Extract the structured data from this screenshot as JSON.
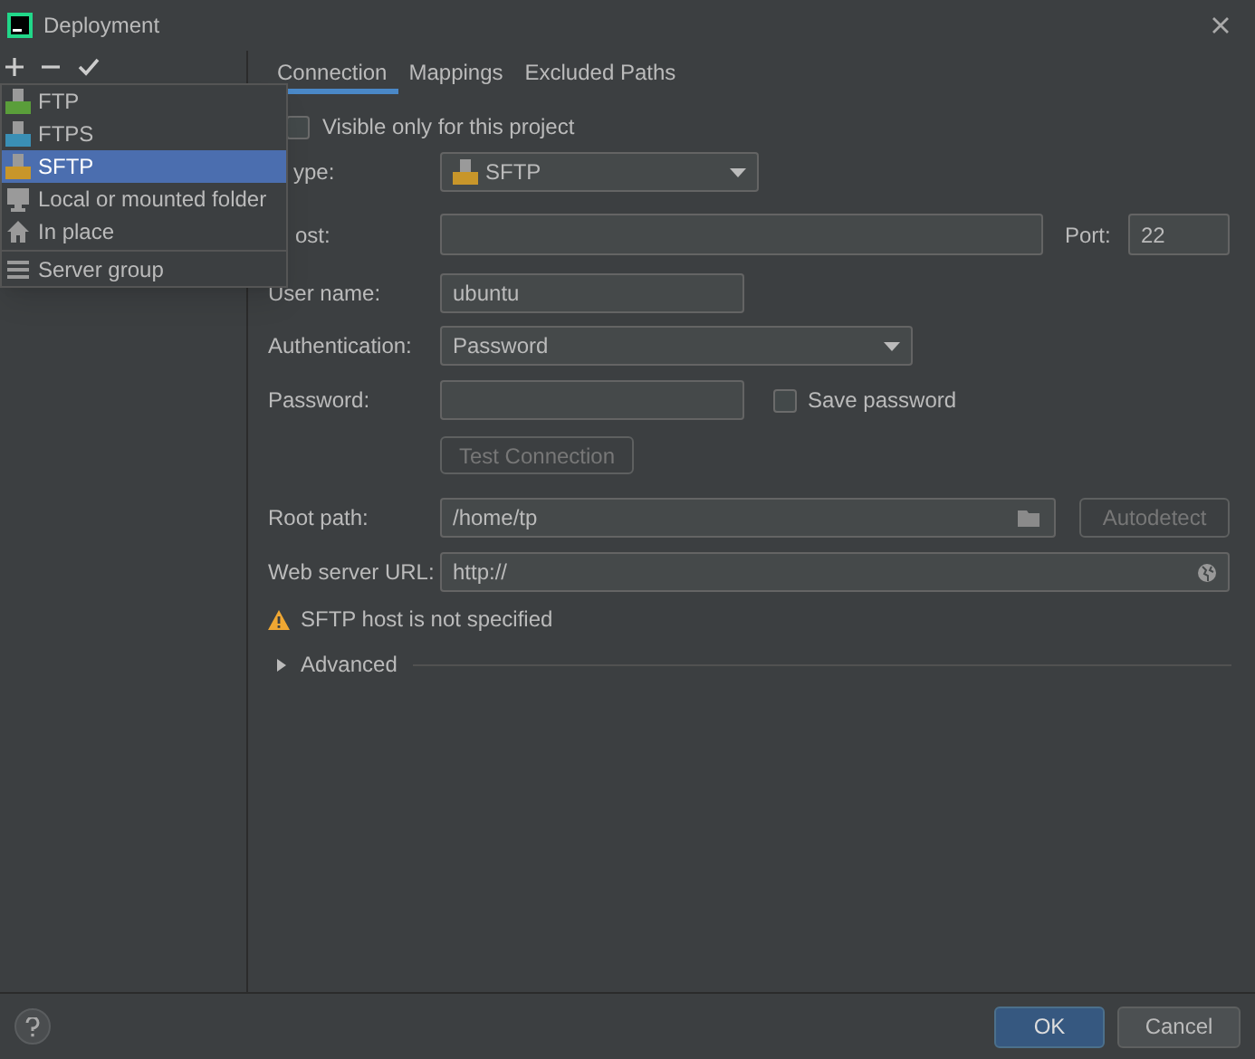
{
  "window": {
    "title": "Deployment"
  },
  "add_menu": {
    "items": [
      {
        "label": "FTP",
        "kind": "ftp",
        "selected": false
      },
      {
        "label": "FTPS",
        "kind": "ftps",
        "selected": false
      },
      {
        "label": "SFTP",
        "kind": "sftp",
        "selected": true
      },
      {
        "label": "Local or mounted folder",
        "kind": "folder",
        "selected": false
      },
      {
        "label": "In place",
        "kind": "home",
        "selected": false
      },
      {
        "label": "Server group",
        "kind": "group",
        "selected": false
      }
    ]
  },
  "tabs": [
    {
      "label": "Connection",
      "selected": true
    },
    {
      "label": "Mappings",
      "selected": false
    },
    {
      "label": "Excluded Paths",
      "selected": false
    }
  ],
  "form": {
    "visible_only": {
      "label": "Visible only for this project",
      "checked": false
    },
    "type": {
      "label": "ype:",
      "value": "SFTP"
    },
    "host": {
      "label": "ost:",
      "port_label": "Port:",
      "port": "22"
    },
    "user_name": {
      "label": "User name:",
      "value": "ubuntu"
    },
    "authentication": {
      "label": "Authentication:",
      "value": "Password"
    },
    "password": {
      "label": "Password:",
      "save_password": {
        "label": "Save password",
        "checked": false
      }
    },
    "test_button": "Test Connection",
    "root_path": {
      "label": "Root path:",
      "value": "/home/tp",
      "button": "Autodetect"
    },
    "web_server_url": {
      "label": "Web server URL:",
      "value": "http://"
    },
    "warning": "SFTP host is not specified",
    "advanced": {
      "label": "Advanced",
      "expanded": false
    }
  },
  "buttons": [
    "OK",
    "Cancel"
  ]
}
